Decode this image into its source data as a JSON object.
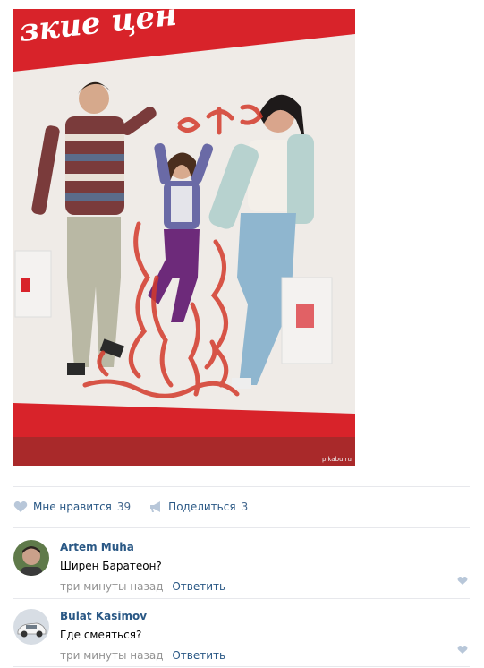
{
  "photo": {
    "watermark": "pikabu.ru",
    "billboard_text": "зкие цен"
  },
  "actions": {
    "like_label": "Мне нравится",
    "like_count": "39",
    "share_label": "Поделиться",
    "share_count": "3"
  },
  "comments": [
    {
      "author": "Artem Muha",
      "text": "Ширен Баратеон?",
      "time": "три минуты назад",
      "reply": "Ответить"
    },
    {
      "author": "Bulat Kasimov",
      "text": "Где смеяться?",
      "time": "три минуты назад",
      "reply": "Ответить"
    }
  ],
  "colors": {
    "link": "#2a5885",
    "muted": "#939393",
    "icon": "#b8c7d9",
    "billboard_red": "#d8232a"
  }
}
